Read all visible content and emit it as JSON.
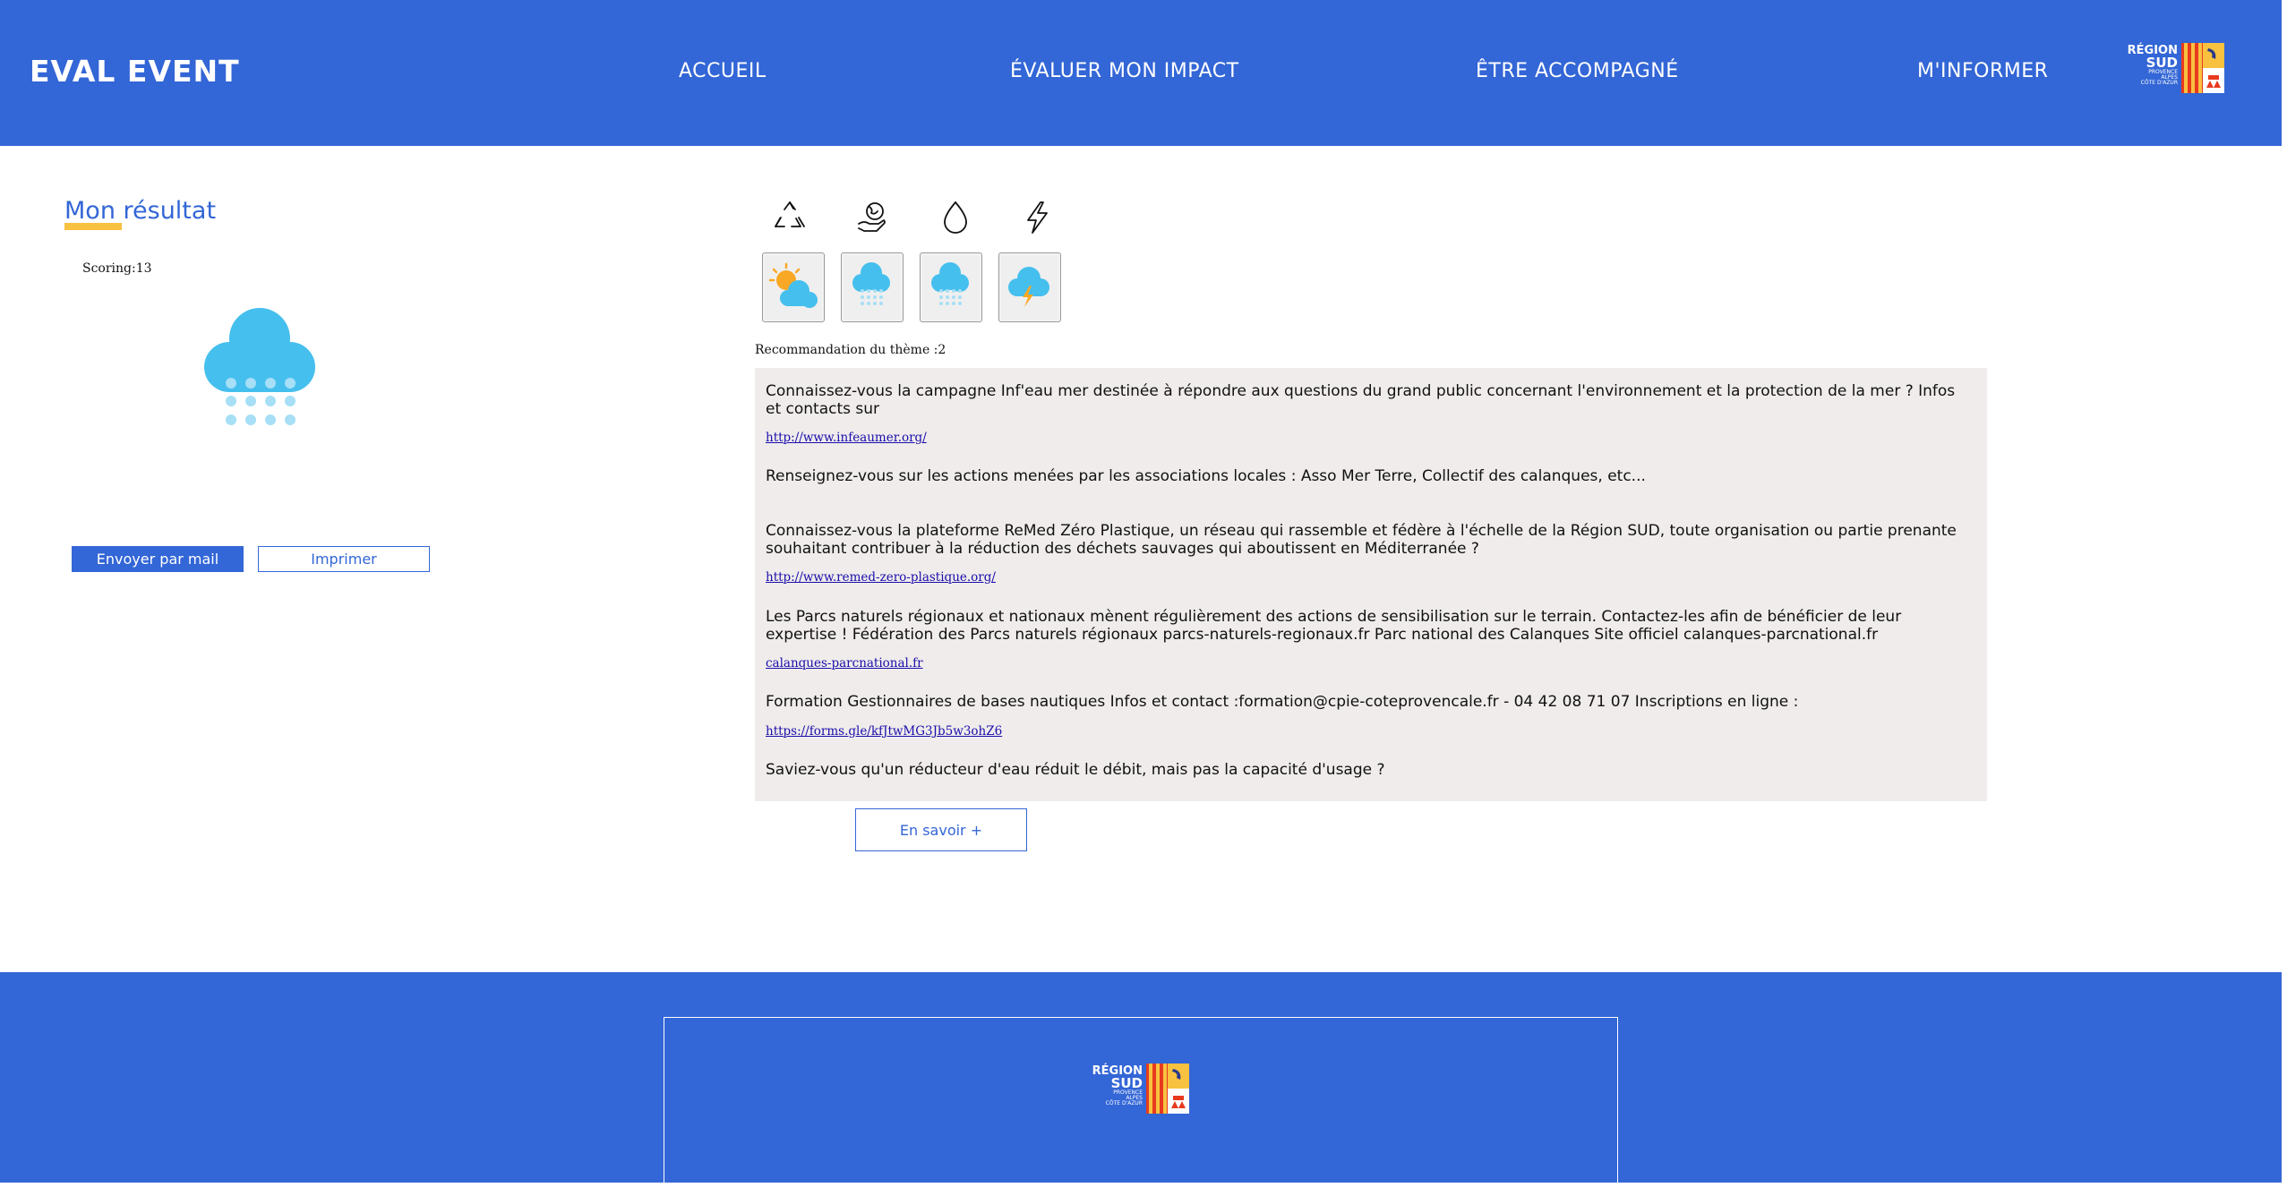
{
  "header": {
    "brand": "EVAL EVENT",
    "nav": [
      {
        "label": "ACCUEIL"
      },
      {
        "label": "ÉVALUER MON IMPACT"
      },
      {
        "label": "ÊTRE ACCOMPAGNÉ"
      },
      {
        "label": "M'INFORMER"
      }
    ],
    "logo": {
      "line1": "RÉGION",
      "line2": "SUD",
      "line3": "PROVENCE",
      "line4": "ALPES",
      "line5": "CÔTE D'AZUR"
    }
  },
  "result": {
    "title": "Mon résultat",
    "scoring": "Scoring:13",
    "weather_icon": "rain-cloud-icon",
    "send_button": "Envoyer par mail",
    "print_button": "Imprimer"
  },
  "themes": {
    "icons": [
      "recycle-icon",
      "hand-globe-icon",
      "water-drop-icon",
      "lightning-icon"
    ],
    "cards": [
      "sun-cloud-icon",
      "rain-cloud-icon",
      "rain-cloud-icon",
      "storm-cloud-icon"
    ]
  },
  "recommendation": {
    "label": "Recommandation du thème :2",
    "items": [
      {
        "text": "Connaissez-vous la campagne Inf'eau mer destinée à répondre aux questions du grand public concernant l'environnement et la protection de la mer ? Infos et contacts sur",
        "link": "http://www.infeaumer.org/"
      },
      {
        "text": "Renseignez-vous sur les actions menées par les associations locales : Asso Mer Terre, Collectif des calanques, etc...",
        "link": ""
      },
      {
        "text": "Connaissez-vous la plateforme ReMed Zéro Plastique, un réseau qui rassemble et fédère à l'échelle de la Région SUD, toute organisation ou partie prenante souhaitant contribuer à la réduction des déchets sauvages qui aboutissent en Méditerranée ?",
        "link": "http://www.remed-zero-plastique.org/"
      },
      {
        "text": "Les Parcs naturels régionaux et nationaux mènent régulièrement des actions de sensibilisation sur le terrain. Contactez-les afin de bénéficier de leur expertise ! Fédération des Parcs naturels régionaux parcs-naturels-regionaux.fr Parc national des Calanques Site officiel calanques-parcnational.fr",
        "link": "calanques-parcnational.fr"
      },
      {
        "text": "Formation Gestionnaires de bases nautiques Infos et contact :formation@cpie-coteprovencale.fr - 04 42 08 71 07 Inscriptions en ligne :",
        "link": "https://forms.gle/kfJtwMG3Jb5w3ohZ6"
      },
      {
        "text": "Saviez-vous qu'un réducteur d'eau réduit le débit, mais pas la capacité d'usage ?",
        "link": ""
      }
    ],
    "more_button": "En savoir +"
  },
  "colors": {
    "primary": "#3366d6",
    "accent": "#f8c140",
    "cloud": "#45bfee",
    "panel": "#efeceb"
  }
}
